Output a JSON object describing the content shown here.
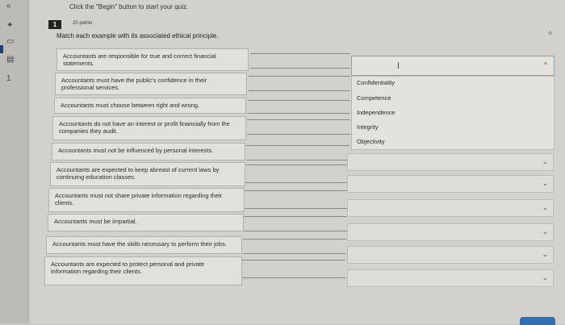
{
  "instruction": "Click the \"Begin\" button to start your quiz.",
  "question": {
    "number": "1",
    "points": "20 points",
    "prompt": "Match each example with its associated ethical principle."
  },
  "rail": {
    "number": "1"
  },
  "items": [
    "Accountants are responsible for true and correct financial statements.",
    "Accountants must have the public's confidence in their professional services.",
    "Accountants must choose between right and wrong.",
    "Accountants do not have an interest or profit financially from the companies they audit.",
    "Accountants must not be influenced by personal interests.",
    "Accountants are expected to keep abreast of current laws by continuing education classes.",
    "Accountants must not share private information regarding their clients.",
    "Accountants must be impartial.",
    "Accountants must have the skills necessary to perform their jobs.",
    "Accountants are expected to protect personal and private information regarding their clients."
  ],
  "options": [
    "Confidentiality",
    "Competence",
    "Independence",
    "Integrity",
    "Objectivity"
  ],
  "icons": {
    "chevron_down": "chevron-down-icon",
    "chevron_up": "chevron-up-icon",
    "pin": "pin-icon",
    "text_cursor": "text-cursor-icon"
  }
}
